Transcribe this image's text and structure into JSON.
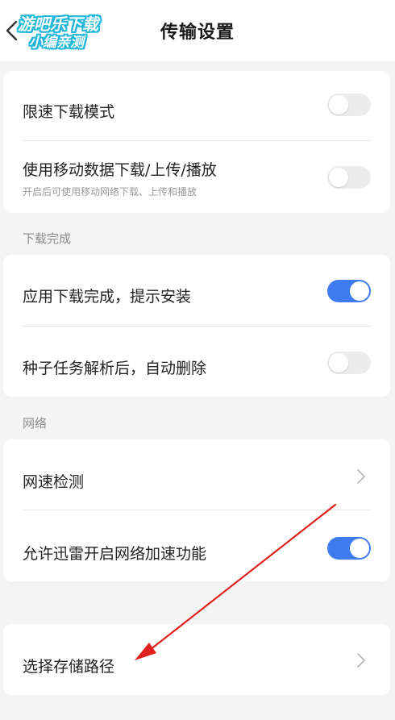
{
  "header": {
    "title": "传输设置",
    "watermark_line1": "游吧乐下载",
    "watermark_line2": "小编亲测"
  },
  "section1": {
    "items": [
      {
        "label": "限速下载模式",
        "toggle": "off"
      },
      {
        "label": "使用移动数据下载/上传/播放",
        "sublabel": "开启后可使用移动网络下载、上传和播放",
        "toggle": "off"
      }
    ]
  },
  "section2": {
    "title": "下载完成",
    "items": [
      {
        "label": "应用下载完成，提示安装",
        "toggle": "on"
      },
      {
        "label": "种子任务解析后，自动删除",
        "toggle": "off"
      }
    ]
  },
  "section3": {
    "title": "网络",
    "items": [
      {
        "label": "网速检测"
      },
      {
        "label": "允许迅雷开启网络加速功能",
        "toggle": "on"
      }
    ]
  },
  "section4": {
    "items": [
      {
        "label": "选择存储路径"
      }
    ]
  },
  "colors": {
    "toggle_on": "#3f7bf0",
    "toggle_off": "#ececec",
    "annotation_arrow": "#e0201c",
    "watermark_outline": "#1fb6d8"
  }
}
